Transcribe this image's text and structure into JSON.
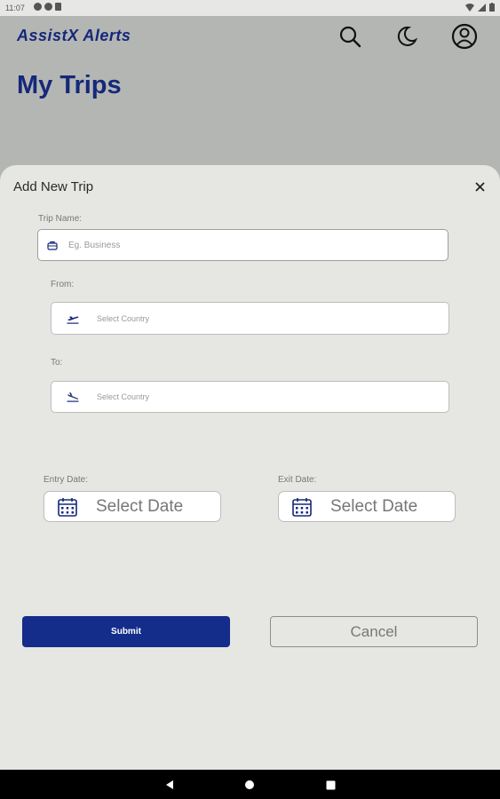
{
  "status_bar": {
    "time": "11:07"
  },
  "header": {
    "brand": "AssistX Alerts",
    "page_title": "My Trips",
    "icons": [
      "search-icon",
      "moon-icon",
      "account-icon"
    ]
  },
  "sheet": {
    "title": "Add New Trip",
    "close_icon": "close-icon",
    "trip_name": {
      "label": "Trip Name:",
      "placeholder": "Eg. Business",
      "icon": "briefcase-icon"
    },
    "from": {
      "label": "From:",
      "placeholder": "Select Country",
      "icon": "flight-takeoff-icon"
    },
    "to": {
      "label": "To:",
      "placeholder": "Select Country",
      "icon": "flight-land-icon"
    },
    "entry_date": {
      "label": "Entry Date:",
      "value": "Select Date",
      "icon": "calendar-icon"
    },
    "exit_date": {
      "label": "Exit Date:",
      "value": "Select Date",
      "icon": "calendar-icon"
    },
    "submit_label": "Submit",
    "cancel_label": "Cancel"
  },
  "colors": {
    "brand": "#15287a",
    "primary_button": "#142c8a",
    "sheet_bg": "#e6e6e3",
    "scrim": "#b4b6b3"
  }
}
